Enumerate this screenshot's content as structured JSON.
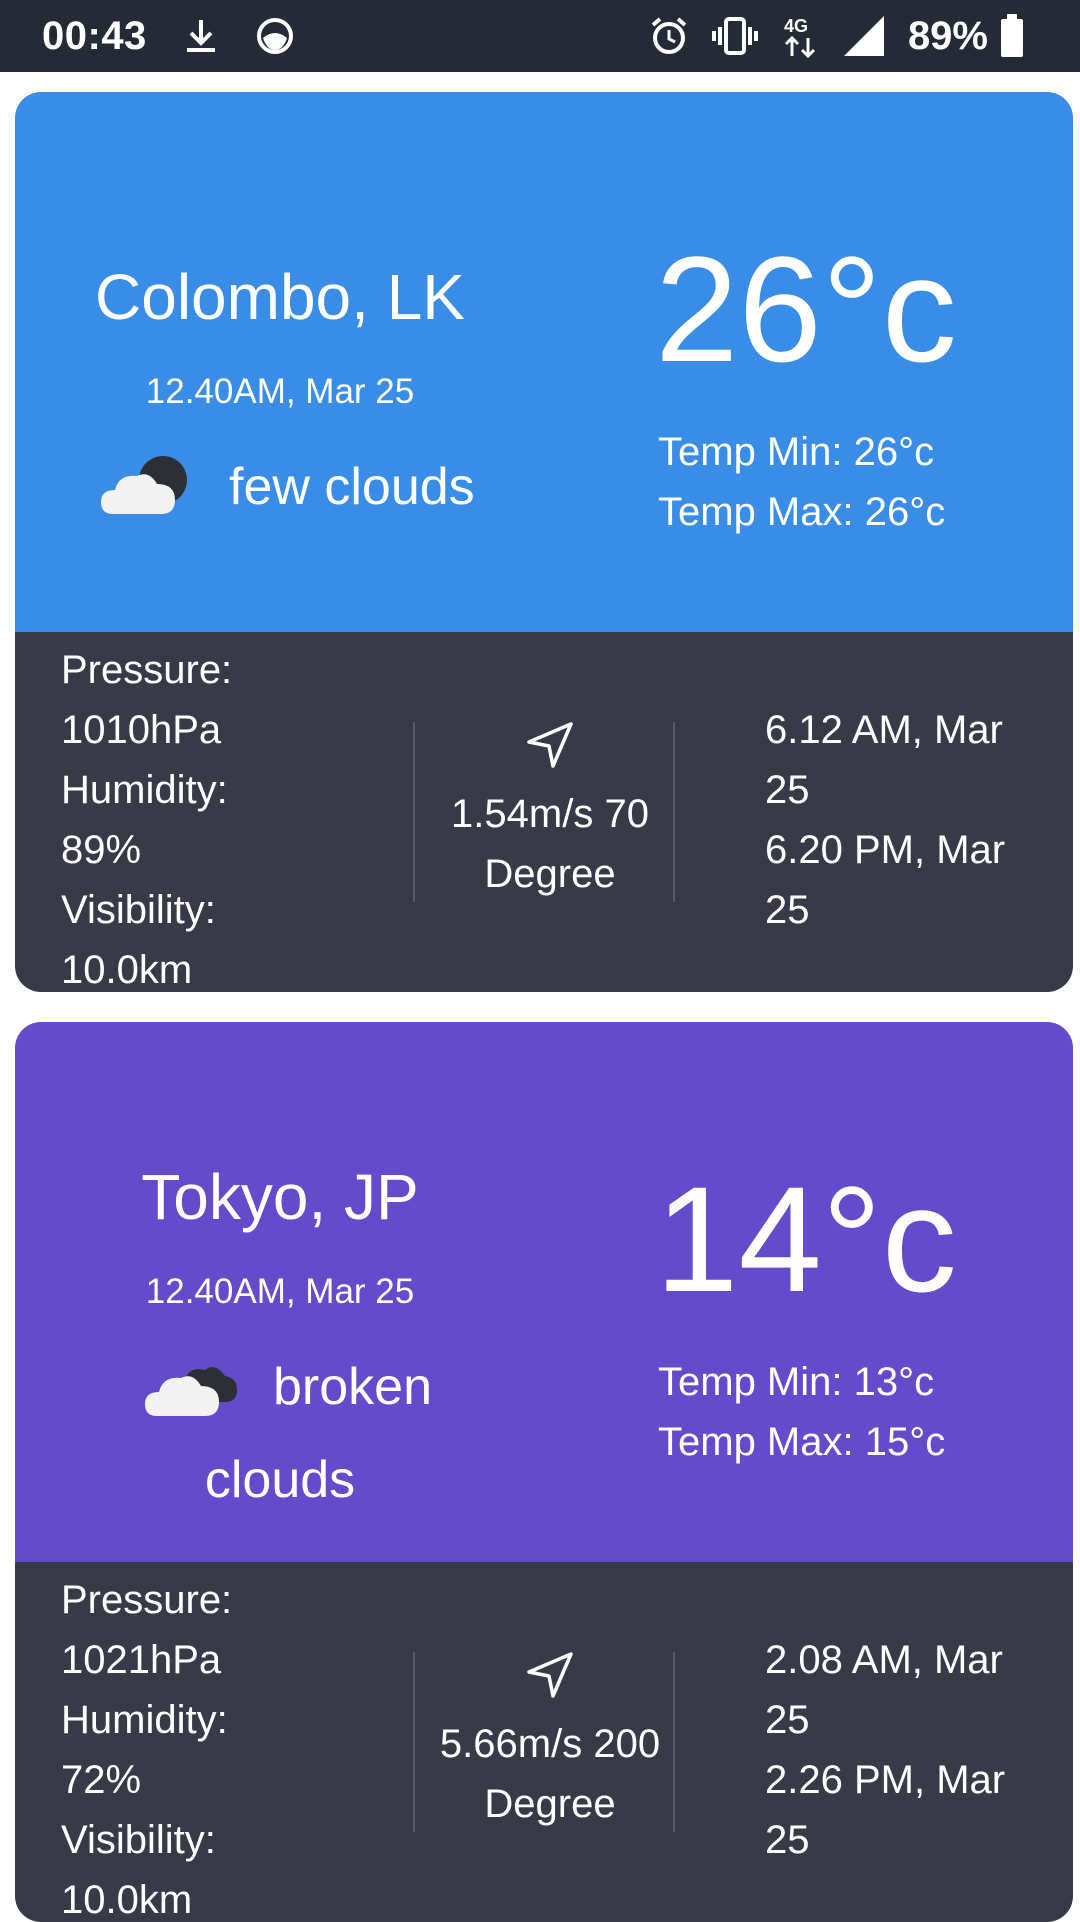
{
  "status_bar": {
    "time": "00:43",
    "battery": "89%",
    "icons": [
      "download-icon",
      "app-icon",
      "alarm-icon",
      "vibrate-icon",
      "network-4g-icon",
      "signal-icon",
      "battery-icon"
    ]
  },
  "colors": {
    "status_bar_bg": "#242b37",
    "card1_top_bg": "#3a8de6",
    "card2_top_bg": "#644bcc",
    "card_bottom_bg": "#393a47"
  },
  "cards": [
    {
      "city": "Colombo, LK",
      "datetime": "12.40AM, Mar 25",
      "description": "few clouds",
      "description_line2": "",
      "icon": "few-clouds-icon",
      "temp": "26°c",
      "temp_min": "Temp Min: 26°c",
      "temp_max": "Temp Max: 26°c",
      "pressure_label": "Pressure:",
      "pressure_value": "1010hPa",
      "humidity_label": "Humidity:",
      "humidity_value": "89%",
      "visibility_label": "Visibility:",
      "visibility_value": "10.0km",
      "wind_line1": "1.54m/s 70",
      "wind_line2": "Degree",
      "sunrise_line1": "6.12 AM, Mar",
      "sunrise_line2": "25",
      "sunset_line1": "6.20 PM, Mar",
      "sunset_line2": "25"
    },
    {
      "city": "Tokyo, JP",
      "datetime": "12.40AM, Mar 25",
      "description": "broken",
      "description_line2": "clouds",
      "icon": "broken-clouds-icon",
      "temp": "14°c",
      "temp_min": "Temp Min: 13°c",
      "temp_max": "Temp Max: 15°c",
      "pressure_label": "Pressure:",
      "pressure_value": "1021hPa",
      "humidity_label": "Humidity:",
      "humidity_value": "72%",
      "visibility_label": "Visibility:",
      "visibility_value": "10.0km",
      "wind_line1": "5.66m/s 200",
      "wind_line2": "Degree",
      "sunrise_line1": "2.08 AM, Mar",
      "sunrise_line2": "25",
      "sunset_line1": "2.26 PM, Mar",
      "sunset_line2": "25"
    }
  ]
}
